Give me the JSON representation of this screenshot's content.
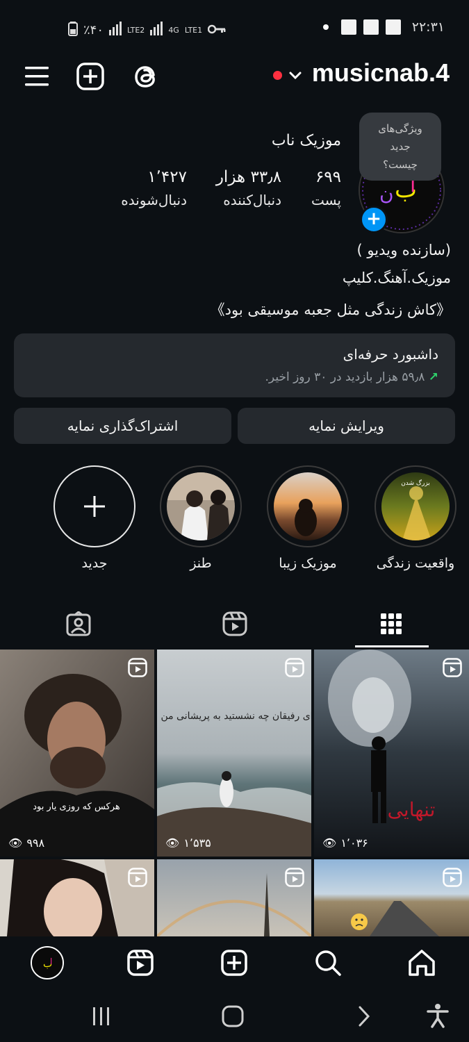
{
  "status_bar": {
    "battery": "٪۴۰",
    "net1": "LTE2",
    "net2": "4G",
    "net3": "LTE1",
    "time": "۲۲:۳۱"
  },
  "header": {
    "username": "musicnab.4",
    "menu_icon": "hamburger-icon",
    "add_icon": "plus-square-icon",
    "threads_icon": "threads-icon"
  },
  "profile": {
    "display_name": "موزیک ناب",
    "tooltip": [
      "ویژگی‌های",
      "جدید",
      "چیست؟"
    ],
    "stats": [
      {
        "num": "۶۹۹",
        "label": "پست"
      },
      {
        "num": "۳۳٫۸ هزار",
        "label": "دنبال‌کننده"
      },
      {
        "num": "۱٬۴۲۷",
        "label": "دنبال‌شونده"
      }
    ],
    "bio": [
      "(سازنده ویدیو )",
      "موزیک.آهنگ.کلیپ",
      "《کاش زندگی مثل جعبه موسیقی بود》"
    ]
  },
  "dashboard": {
    "title": "داشبورد حرفه‌ای",
    "subtitle": "۵۹٫۸ هزار بازدید در ۳۰ روز اخیر."
  },
  "buttons": {
    "edit": "ویرایش نمایه",
    "share": "اشتراک‌گذاری نمایه"
  },
  "highlights": [
    {
      "label": "واقعیت زندگی",
      "overlay": "بزرگ شدن"
    },
    {
      "label": "موزیک زیبا"
    },
    {
      "label": "طنز"
    },
    {
      "label": "جدید"
    }
  ],
  "posts": [
    {
      "views": "۹۹۸",
      "caption": "هرکس که روزی یار بود"
    },
    {
      "views": "۱٬۵۳۵",
      "caption": "ای رفیقان چه نشستید به پریشانی من"
    },
    {
      "views": "۱٬۰۳۶",
      "caption": "تنهایی"
    },
    {
      "views": ""
    },
    {
      "views": ""
    },
    {
      "views": ""
    }
  ],
  "colors": {
    "background": "#0c1014",
    "surface": "#25292e",
    "accent": "#0095f6",
    "notification": "#ff3040"
  }
}
